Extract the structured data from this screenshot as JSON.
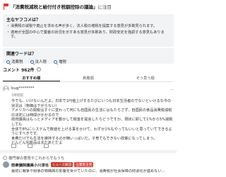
{
  "header": {
    "title": "「消費税減税と給付付き税額控除の議論」",
    "attention": "に注目"
  },
  "main_points": {
    "title": "主なヤフコメは？",
    "items": [
      "消費税の減税や廃止を求める声が多く、法人税の増税を提案する意見が多数見られます。",
      "適用が全国の中心で業者の状況を示すある意見が多数あり、財政安定を強調する意見もあります。"
    ]
  },
  "keywords": {
    "title": "関連ワードは？",
    "items": [
      "消費税",
      "法人税",
      "増税"
    ]
  },
  "comments": {
    "title": "コメント 962件",
    "help": "?",
    "tabs": [
      "おすすめ順",
      "新着順",
      "そう思う順"
    ]
  },
  "comment": {
    "user": "bug********",
    "more": "…",
    "time": "1時間前",
    "body": [
      "今でも、いけないんだよ。日本で1円値上げするたびにいつも日本生活者のでないといけるな今の状況は（物価は下がらない）",
      "アメリカへの関税はすぐに変わって何にも自国民の生活にはもたらさず、自国民の食品消費税減税の決定には時間がかかるので",
      "政府議員はもっとメディアを動かして税金を提言したらどうですか、現状に即して1%から5%減税しても",
      "全体で8%にシステムで数値を上げる事をかけて、わずか1%もやってもいいと思っていてできるようにすべきです。",
      "食費だけでも生活を維持するのが精いっぱいだ。子育てもできない政策になってしまう。",
      "どんどん化粧品はまだあとだよ"
    ]
  },
  "reader_label": "専門家の意見やこれからでもうち",
  "expert": {
    "name": "前衆議院議員小川淳也",
    "badges": [
      "ニュース解説",
      "立憲民主党"
    ],
    "text": "最初に戦争や紛争の物価高の影響を受けていたのに、消費税が社会保障の財源化が進めない…"
  }
}
